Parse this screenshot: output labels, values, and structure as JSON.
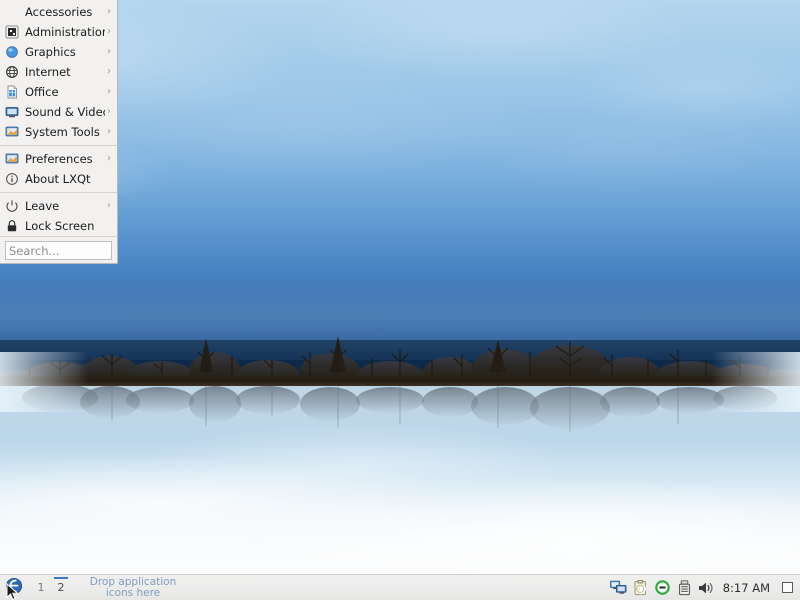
{
  "desktop": {
    "wallpaper_name": "misty-lake-treeline",
    "colors": {
      "sky_top": "#b4d6ee",
      "sky_horizon": "#2f5f9c",
      "tree_silhouette": "#241d14",
      "water_top": "#bcd4e4",
      "water_bottom": "#f4f7fa"
    }
  },
  "menu": {
    "name": "LXQt Application Menu",
    "items": [
      {
        "label": "Accessories",
        "icon": "accessories-icon",
        "submenu": true
      },
      {
        "label": "Administration",
        "icon": "administration-icon",
        "submenu": true
      },
      {
        "label": "Graphics",
        "icon": "graphics-icon",
        "submenu": true
      },
      {
        "label": "Internet",
        "icon": "internet-icon",
        "submenu": true
      },
      {
        "label": "Office",
        "icon": "office-icon",
        "submenu": true
      },
      {
        "label": "Sound & Video",
        "icon": "sound-video-icon",
        "submenu": true
      },
      {
        "label": "System Tools",
        "icon": "system-tools-icon",
        "submenu": true
      }
    ],
    "items_secondary": [
      {
        "label": "Preferences",
        "icon": "preferences-icon",
        "submenu": true
      },
      {
        "label": "About LXQt",
        "icon": "info-icon",
        "submenu": false
      }
    ],
    "items_session": [
      {
        "label": "Leave",
        "icon": "power-icon",
        "submenu": true
      },
      {
        "label": "Lock Screen",
        "icon": "lock-icon",
        "submenu": false
      }
    ],
    "arrow_glyph": "›",
    "search": {
      "value": "",
      "placeholder": "Search..."
    }
  },
  "taskbar": {
    "start_button": {
      "label": "",
      "icon": "lxqt-logo-icon",
      "tooltip": "Menu"
    },
    "pager": {
      "desktops": [
        {
          "label": "1",
          "active": false
        },
        {
          "label": "2",
          "active": true
        }
      ]
    },
    "quicklaunch": {
      "text": "Drop application\nicons here"
    },
    "tray": [
      {
        "name": "network-monitors-icon",
        "title": "Network"
      },
      {
        "name": "clipboard-icon",
        "title": "Clipboard"
      },
      {
        "name": "do-not-disturb-icon",
        "title": "Notifications"
      },
      {
        "name": "usb-device-icon",
        "title": "Removable media"
      },
      {
        "name": "volume-icon",
        "title": "Volume"
      }
    ],
    "clock": {
      "time": "8:17 AM"
    },
    "show_desktop": {
      "name": "show-desktop-button"
    }
  }
}
